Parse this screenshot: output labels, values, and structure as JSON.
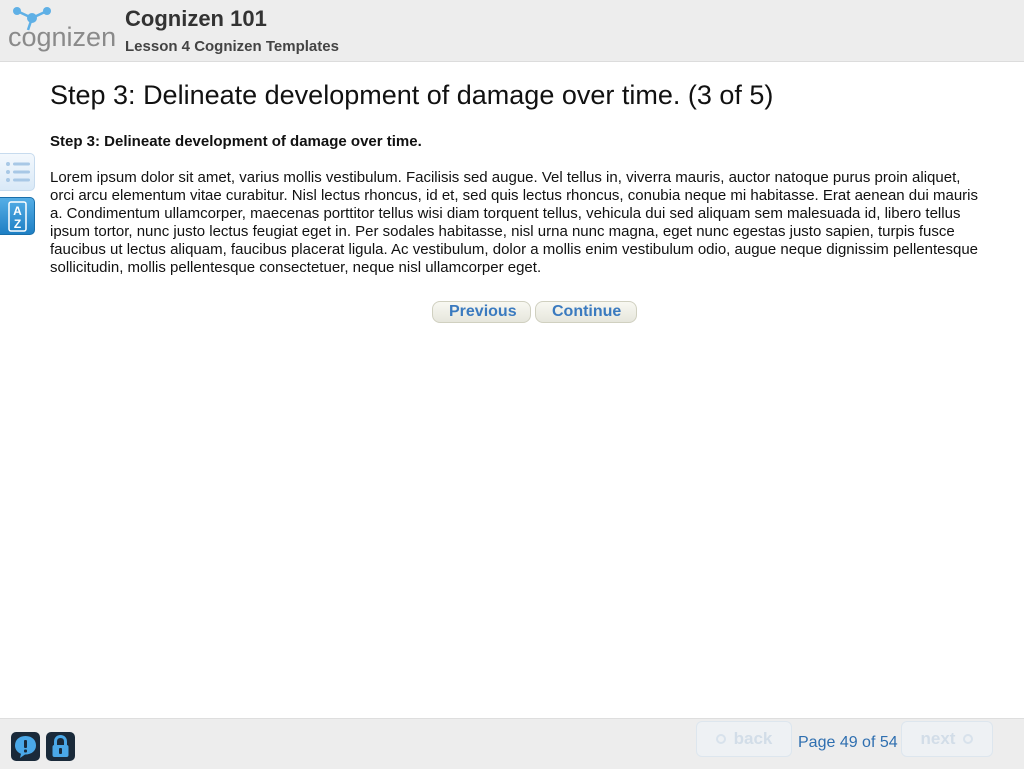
{
  "header": {
    "logo_text": "cognizen",
    "course_title": "Cognizen 101",
    "lesson_title": "Lesson 4 Cognizen Templates"
  },
  "content": {
    "page_title": "Step 3: Delineate development of damage over time.  (3 of 5)",
    "step_heading": "Step 3: Delineate development of damage over time.",
    "body": "Lorem ipsum dolor sit amet, varius mollis vestibulum. Facilisis sed augue. Vel tellus in, viverra mauris, auctor natoque purus proin aliquet, orci arcu elementum vitae curabitur. Nisl lectus rhoncus, id et, sed quis lectus rhoncus, conubia neque mi habitasse. Erat aenean dui mauris a. Condimentum ullamcorper, maecenas porttitor tellus wisi diam torquent tellus, vehicula dui sed aliquam sem malesuada id, libero tellus ipsum tortor, nunc justo lectus feugiat eget in. Per sodales habitasse, nisl urna nunc magna, eget nunc egestas justo sapien, turpis fusce faucibus ut lectus aliquam, faucibus placerat ligula. Ac vestibulum, dolor a mollis enim vestibulum odio, augue neque dignissim pellentesque sollicitudin, mollis pellentesque consectetuer, neque nisl ullamcorper eget."
  },
  "sidebar": {
    "toc_icon": "list-icon",
    "glossary_icon": "a-z-glossary-icon",
    "glossary_letters": [
      "A",
      "Z"
    ]
  },
  "buttons": {
    "previous": "Previous",
    "continue": "Continue"
  },
  "footer": {
    "help_icon": "help-speech-icon",
    "lock_icon": "lock-icon",
    "back_label": "back",
    "next_label": "next",
    "page_indicator": "Page 49 of 54"
  },
  "colors": {
    "accent_blue": "#3a7abf",
    "glossary_blue": "#1e7fc4",
    "header_bg": "#ededed"
  }
}
